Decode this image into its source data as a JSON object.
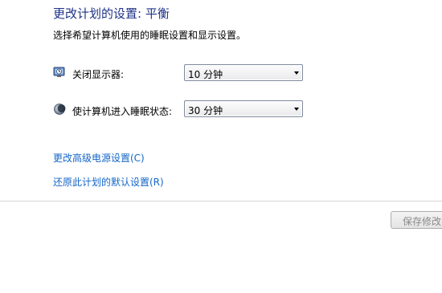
{
  "page": {
    "title": "更改计划的设置: 平衡",
    "subtitle": "选择希望计算机使用的睡眠设置和显示设置。"
  },
  "settings": [
    {
      "icon": "monitor-clock-icon",
      "label": "关闭显示器:",
      "value": "10 分钟"
    },
    {
      "icon": "moon-icon",
      "label": "使计算机进入睡眠状态:",
      "value": "30 分钟"
    }
  ],
  "links": {
    "advanced": "更改高级电源设置(C)",
    "restore": "还原此计划的默认设置(R)"
  },
  "buttons": {
    "save": "保存修改"
  },
  "colors": {
    "title": "#1e3287",
    "link": "#1466c8",
    "disabled_text": "#8a8a8a"
  }
}
